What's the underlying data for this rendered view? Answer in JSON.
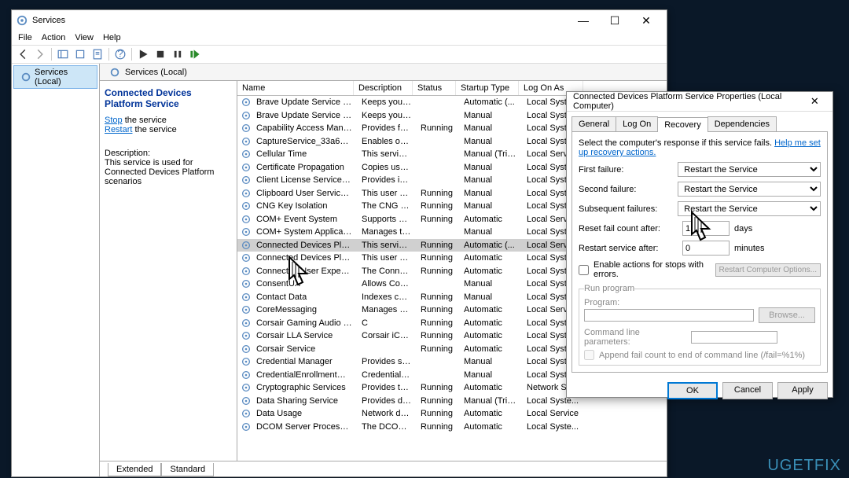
{
  "mainWindow": {
    "title": "Services",
    "menu": [
      "File",
      "Action",
      "View",
      "Help"
    ],
    "winCtrls": {
      "min": "—",
      "max": "☐",
      "close": "✕"
    },
    "treeLabel": "Services (Local)",
    "paneHeader": "Services (Local)",
    "detail": {
      "heading": "Connected Devices Platform Service",
      "stopPrefix": "Stop",
      "stopSuffix": " the service",
      "restartPrefix": "Restart",
      "restartSuffix": " the service",
      "descLabel": "Description:",
      "desc": "This service is used for Connected Devices Platform scenarios"
    },
    "columns": [
      "Name",
      "Description",
      "Status",
      "Startup Type",
      "Log On As"
    ],
    "rows": [
      [
        "Brave Update Service (brave)",
        "Keeps your ...",
        "",
        "Automatic (...",
        "Local Syste..."
      ],
      [
        "Brave Update Service (brave...",
        "Keeps your ...",
        "",
        "Manual",
        "Local Syste..."
      ],
      [
        "Capability Access Manager ...",
        "Provides fac...",
        "Running",
        "Manual",
        "Local Syste..."
      ],
      [
        "CaptureService_33a6c70f",
        "Enables opti...",
        "",
        "Manual",
        "Local Syste..."
      ],
      [
        "Cellular Time",
        "This service ...",
        "",
        "Manual (Trig...",
        "Local Service"
      ],
      [
        "Certificate Propagation",
        "Copies user ...",
        "",
        "Manual",
        "Local Syste..."
      ],
      [
        "Client License Service (ClipS...",
        "Provides inf...",
        "",
        "Manual",
        "Local Syste..."
      ],
      [
        "Clipboard User Service_33a6...",
        "This user ser...",
        "Running",
        "Manual",
        "Local Syste..."
      ],
      [
        "CNG Key Isolation",
        "The CNG ke...",
        "Running",
        "Manual",
        "Local Syste..."
      ],
      [
        "COM+ Event System",
        "Supports Sy...",
        "Running",
        "Automatic",
        "Local Service"
      ],
      [
        "COM+ System Application",
        "Manages th...",
        "",
        "Manual",
        "Local Syste..."
      ],
      [
        "Connected Devices Platfor...",
        "This service ...",
        "Running",
        "Automatic (...",
        "Local Service"
      ],
      [
        "Connected Devices Platfor...",
        "This user ser...",
        "Running",
        "Automatic",
        "Local Syste..."
      ],
      [
        "Connected User Experience...",
        "The Connec...",
        "Running",
        "Automatic",
        "Local Syste..."
      ],
      [
        "ConsentUX",
        "Allows Con...",
        "",
        "Manual",
        "Local Syste..."
      ],
      [
        "Contact Data",
        "Indexes con...",
        "Running",
        "Manual",
        "Local Syste..."
      ],
      [
        "CoreMessaging",
        "Manages co...",
        "Running",
        "Automatic",
        "Local Service"
      ],
      [
        "Corsair Gaming Audio Conf...",
        "C",
        "Running",
        "Automatic",
        "Local Syste..."
      ],
      [
        "Corsair LLA Service",
        "Corsair iCU...",
        "Running",
        "Automatic",
        "Local Syste..."
      ],
      [
        "Corsair Service",
        "",
        "Running",
        "Automatic",
        "Local Syste..."
      ],
      [
        "Credential Manager",
        "Provides se...",
        "",
        "Manual",
        "Local Syste..."
      ],
      [
        "CredentialEnrollmentMana...",
        "Credential E...",
        "",
        "Manual",
        "Local Syste..."
      ],
      [
        "Cryptographic Services",
        "Provides thr...",
        "Running",
        "Automatic",
        "Network S..."
      ],
      [
        "Data Sharing Service",
        "Provides da...",
        "Running",
        "Manual (Trig...",
        "Local Syste..."
      ],
      [
        "Data Usage",
        "Network da...",
        "Running",
        "Automatic",
        "Local Service"
      ],
      [
        "DCOM Server Process Laun...",
        "The DCOML...",
        "Running",
        "Automatic",
        "Local Syste..."
      ]
    ],
    "tabs": [
      "Extended",
      "Standard"
    ]
  },
  "dialog": {
    "title": "Connected Devices Platform Service Properties (Local Computer)",
    "tabs": [
      "General",
      "Log On",
      "Recovery",
      "Dependencies"
    ],
    "hint": "Select the computer's response if this service fails.",
    "hintLink": "Help me set up recovery actions.",
    "labels": {
      "first": "First failure:",
      "second": "Second failure:",
      "subseq": "Subsequent failures:",
      "reset": "Reset fail count after:",
      "restart": "Restart service after:",
      "days": "days",
      "mins": "minutes",
      "enable": "Enable actions for stops with errors.",
      "restartOpts": "Restart Computer Options...",
      "runProg": "Run program",
      "program": "Program:",
      "browse": "Browse...",
      "cmdline": "Command line parameters:",
      "append": "Append fail count to end of command line (/fail=%1%)"
    },
    "values": {
      "first": "Restart the Service",
      "second": "Restart the Service",
      "subseq": "Restart the Service",
      "reset": "1",
      "restart": "0"
    },
    "buttons": {
      "ok": "OK",
      "cancel": "Cancel",
      "apply": "Apply"
    }
  },
  "logo": "UGETFIX"
}
